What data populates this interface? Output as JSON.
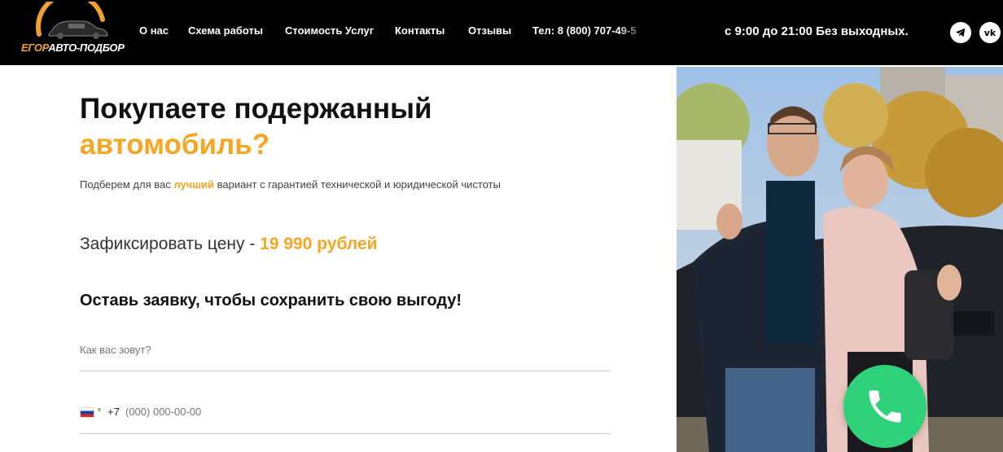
{
  "logo": {
    "part1": "ЕГОР",
    "part2": "АВТО-ПОДБОР"
  },
  "nav": {
    "items": [
      {
        "label": "О нас"
      },
      {
        "label": "Схема работы"
      },
      {
        "label": "Стоимость Услуг"
      },
      {
        "label": "Контакты"
      },
      {
        "label": "Отзывы"
      }
    ],
    "phone": "Тел: 8 (800) 707-49-5"
  },
  "hours": "с 9:00 до 21:00 Без выходных.",
  "social": {
    "telegram": "telegram-icon",
    "vk": "vk-icon",
    "vk_text": "vk"
  },
  "hero": {
    "title_line1": "Покупаете подержанный",
    "title_line2": "автомобиль?",
    "subtitle_pre": "Подберем для вас ",
    "subtitle_highlight": "лучший",
    "subtitle_post": " вариант с гарантией технической и юридической чистоты",
    "price_label": "Зафиксировать цену - ",
    "price_value": "19 990 рублей",
    "cta": "Оставь заявку, чтобы сохранить свою выгоду!"
  },
  "form": {
    "name_placeholder": "Как вас зовут?",
    "phone_code": "+7",
    "phone_placeholder": "(000) 000-00-00"
  },
  "colors": {
    "accent": "#f5a623",
    "call_button": "#2fd27a",
    "header_bg": "#000000"
  }
}
